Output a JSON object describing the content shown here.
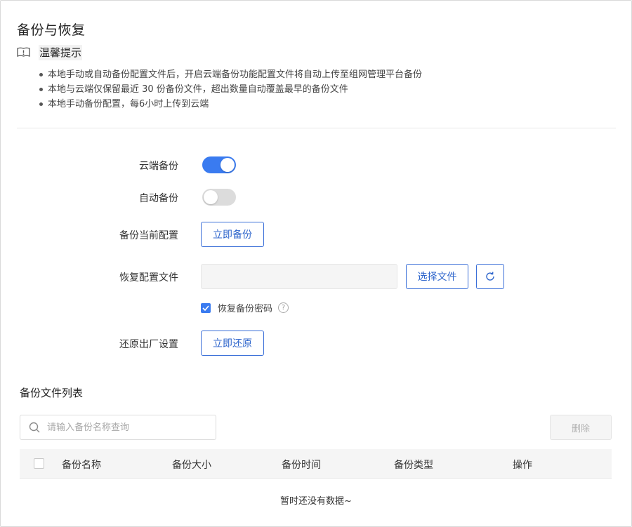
{
  "page": {
    "title": "备份与恢复"
  },
  "tips": {
    "title": "温馨提示",
    "icon": "info-book-icon",
    "items": [
      "本地手动或自动备份配置文件后，开启云端备份功能配置文件将自动上传至组网管理平台备份",
      "本地与云端仅保留最近 30 份备份文件，超出数量自动覆盖最早的备份文件",
      "本地手动备份配置，每6小时上传到云端"
    ]
  },
  "form": {
    "cloud_backup": {
      "label": "云端备份",
      "enabled": true
    },
    "auto_backup": {
      "label": "自动备份",
      "enabled": false
    },
    "backup_current": {
      "label": "备份当前配置",
      "button": "立即备份"
    },
    "restore_file": {
      "label": "恢复配置文件",
      "select_button": "选择文件",
      "refresh_icon": "refresh-icon"
    },
    "restore_password": {
      "label": "恢复备份密码",
      "checked": true,
      "help_icon": "question-circle-icon"
    },
    "factory_reset": {
      "label": "还原出厂设置",
      "button": "立即还原"
    }
  },
  "file_list": {
    "title": "备份文件列表",
    "search": {
      "placeholder": "请输入备份名称查询",
      "value": ""
    },
    "delete_button": "删除",
    "columns": [
      "备份名称",
      "备份大小",
      "备份时间",
      "备份类型",
      "操作"
    ],
    "rows": [],
    "empty_text": "暂时还没有数据~"
  },
  "colors": {
    "accent": "#3a7bf0",
    "button_border": "#3a6fd8",
    "switch_off": "#dcdcdc",
    "table_header_bg": "#f5f5f5"
  }
}
